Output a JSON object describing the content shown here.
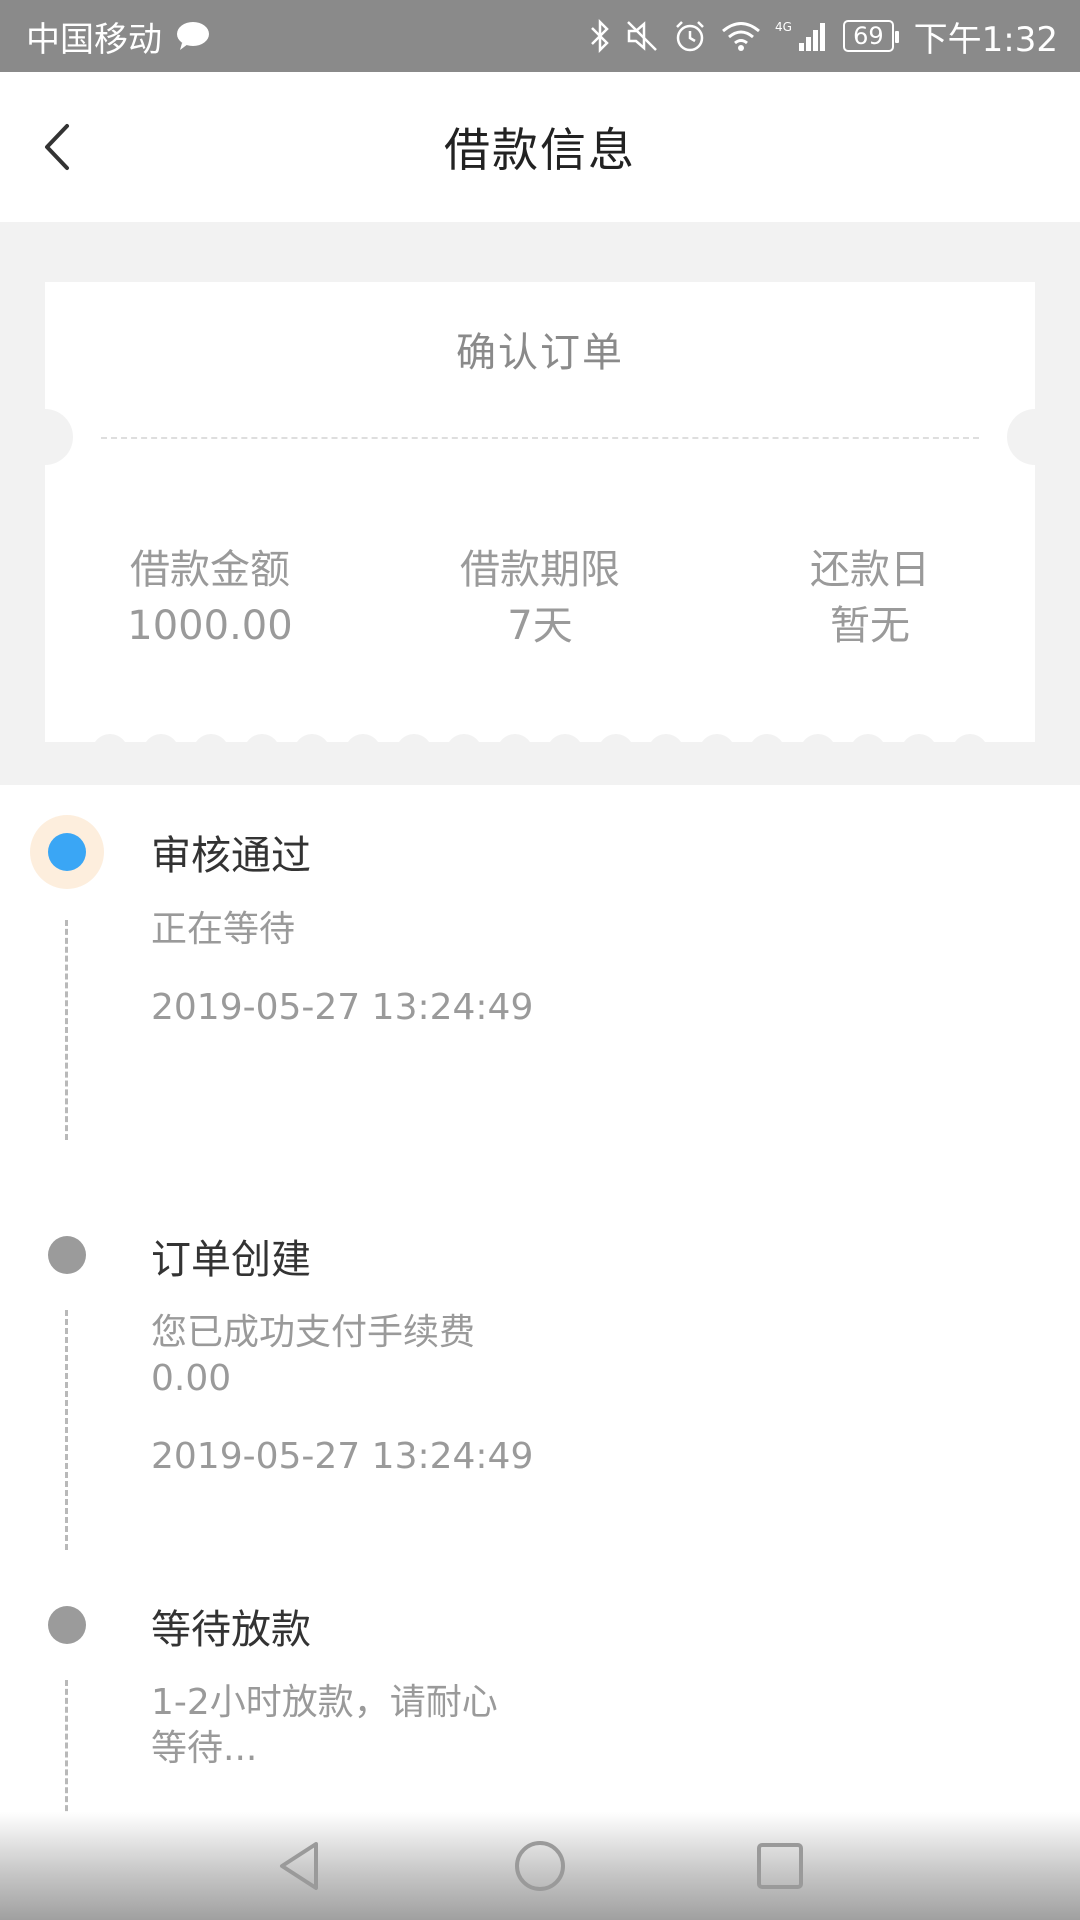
{
  "status_bar": {
    "carrier": "中国移动",
    "time": "下午1:32",
    "battery": "69",
    "network": "4G"
  },
  "header": {
    "title": "借款信息"
  },
  "order": {
    "title": "确认订单",
    "loan_amount_label": "借款金额",
    "loan_amount_value": "1000.00",
    "loan_term_label": "借款期限",
    "loan_term_value": "7天",
    "repay_day_label": "还款日",
    "repay_day_value": "暂无"
  },
  "timeline": [
    {
      "title": "审核通过",
      "desc": "正在等待",
      "time": "2019-05-27 13:24:49",
      "status": "active"
    },
    {
      "title": "订单创建",
      "desc_line1": "您已成功支付手续费",
      "desc_line2": "0.00",
      "time": "2019-05-27 13:24:49",
      "status": "done"
    },
    {
      "title": "等待放款",
      "desc_line1": "1-2小时放款，请耐心",
      "desc_line2": "等待...",
      "status": "pending"
    }
  ],
  "colors": {
    "status_bar": "#8a8a8a",
    "active_dot": "#3aa6f5",
    "active_halo": "#fdeedd",
    "inactive_dot": "#9b9b9b",
    "page_bg": "#f2f2f2"
  },
  "icons": [
    "message-icon",
    "bluetooth-icon",
    "mute-icon",
    "alarm-icon",
    "wifi-icon",
    "signal-icon",
    "battery-icon",
    "back-arrow-icon",
    "nav-back-icon",
    "nav-home-icon",
    "nav-recent-icon"
  ]
}
